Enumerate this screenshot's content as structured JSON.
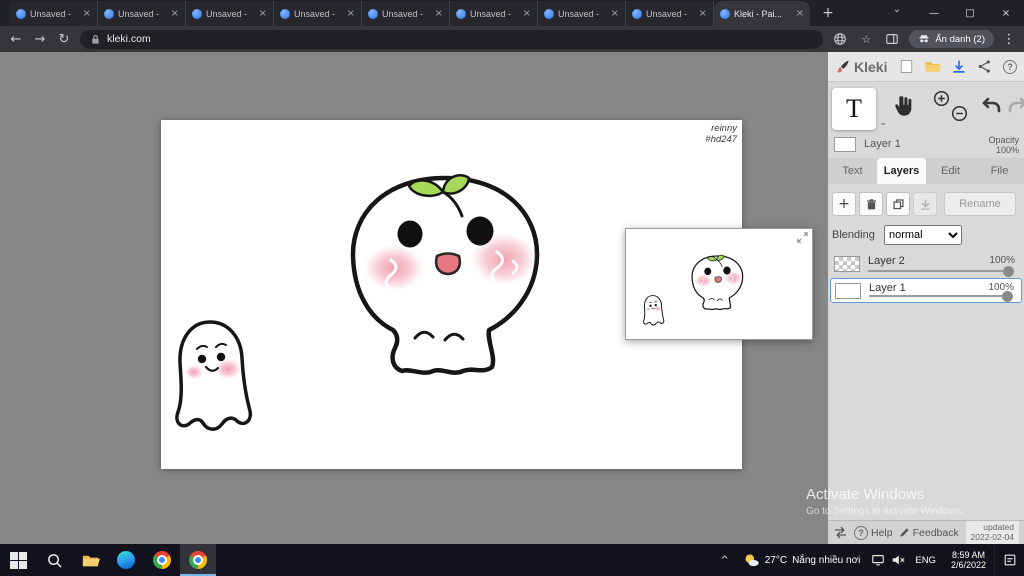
{
  "icons": {
    "close": "×",
    "plus": "+",
    "menu_dots": "⋮",
    "star": "☆",
    "back": "←",
    "forward": "→",
    "reload": "↻",
    "chevron_down": "⌄",
    "chevron_up": "^",
    "minimize": "—",
    "maximize": "□",
    "question": "?"
  },
  "browser": {
    "tabs": [
      {
        "label": "Unsaved -"
      },
      {
        "label": "Unsaved -"
      },
      {
        "label": "Unsaved -"
      },
      {
        "label": "Unsaved -"
      },
      {
        "label": "Unsaved -"
      },
      {
        "label": "Unsaved -"
      },
      {
        "label": "Unsaved -"
      },
      {
        "label": "Unsaved -"
      },
      {
        "label": "Kleki - Pai...",
        "active": true
      }
    ],
    "url": "kleki.com",
    "incognito_badge": "Ẩn danh (2)"
  },
  "kleki": {
    "brand": "Kleki",
    "text_tool_label": "T",
    "current_layer": {
      "name": "Layer 1",
      "opacity_label": "Opacity",
      "opacity_value": "100%"
    },
    "tabs": [
      {
        "label": "Text"
      },
      {
        "label": "Layers",
        "active": true
      },
      {
        "label": "Edit"
      },
      {
        "label": "File"
      }
    ],
    "rename_label": "Rename",
    "blending_label": "Blending",
    "blending_value": "normal",
    "layers": [
      {
        "name": "Layer 2",
        "opacity": "100%"
      },
      {
        "name": "Layer 1",
        "opacity": "100%",
        "selected": true
      }
    ],
    "footer": {
      "help": "Help",
      "feedback": "Feedback",
      "updated_label": "updated",
      "updated_date": "2022-02-04"
    }
  },
  "canvas": {
    "signature_line1": "reinny",
    "signature_line2": "#hd247"
  },
  "watermark": {
    "line1": "Activate Windows",
    "line2": "Go to Settings to activate Windows."
  },
  "taskbar": {
    "temperature": "27°C",
    "weather": "Nắng nhiều nơi",
    "language": "ENG",
    "time": "8:59 AM",
    "date": "2/6/2022"
  },
  "colors": {
    "accent_blue": "#1a73e8",
    "download_blue": "#2a6af0",
    "selected_layer_border": "#5b9bd5",
    "folder_yellow": "#f2b23c",
    "leaf_green": "#a8d85a",
    "blush_pink": "#f2a9b8",
    "taskbar_active_underline": "#76b9ed"
  }
}
